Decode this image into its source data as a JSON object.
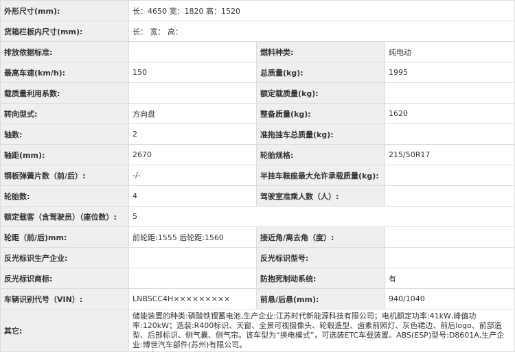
{
  "rows": [
    {
      "l1": "外形尺寸(mm):",
      "v1": "长：4650 宽：1820 高：1520"
    },
    {
      "l1": "货箱栏板内尺寸(mm):",
      "v1": "长： 宽： 高："
    },
    {
      "l1": "排放依据标准:",
      "v1": "",
      "l2": "燃料种类:",
      "v2": "纯电动"
    },
    {
      "l1": "最高车速(km/h):",
      "v1": "150",
      "l2": "总质量(kg):",
      "v2": "1995"
    },
    {
      "l1": "载质量利用系数:",
      "v1": "",
      "l2": "额定载质量(kg):",
      "v2": ""
    },
    {
      "l1": "转向型式:",
      "v1": "方向盘",
      "l2": "整备质量(kg):",
      "v2": "1620"
    },
    {
      "l1": "轴数:",
      "v1": "2",
      "l2": "准拖挂车总质量(kg):",
      "v2": ""
    },
    {
      "l1": "轴距(mm):",
      "v1": "2670",
      "l2": "轮胎规格:",
      "v2": "215/50R17"
    },
    {
      "l1": "钢板弹簧片数（前/后）:",
      "v1": "-/-",
      "l2": "半挂车鞍座最大允许承载质量(kg):",
      "v2": ""
    },
    {
      "l1": "轮胎数:",
      "v1": "4",
      "l2": "驾驶室准乘人数（人）:",
      "v2": ""
    },
    {
      "l1": "额定载客（含驾驶员）（座位数）:",
      "v1": "5"
    },
    {
      "l1": "轮距（前/后)mm:",
      "v1": "前轮距:1555 后轮距:1560",
      "l2": "接近角/离去角（度）:",
      "v2": ""
    },
    {
      "l1": "反光标识生产企业:",
      "v1": "",
      "l2": "反光标识型号:",
      "v2": ""
    },
    {
      "l1": "反光标识商标:",
      "v1": "",
      "l2": "防抱死制动系统:",
      "v2": "有"
    },
    {
      "l1": "车辆识别代号（VIN）:",
      "v1": "LNBSCC4H×××××××××",
      "l2": "前悬/后悬(mm):",
      "v2": "940/1040"
    }
  ],
  "other": {
    "label": "其它:",
    "value": "储能装置的种类:磷酸铁锂蓄电池,生产企业:江苏时代新能源科技有限公司；电机额定功率:41kW,峰值功率:120kW；选装:R400标识、天窗、全景可视摄像头、轮毂造型、卤素前照灯、灰色裙边、前后logo、前部造型、后部标识、侧气囊、侧气帘。该车型为“换电模式”，可选装ETC车载装置。ABS(ESP)型号:D8601A,生产企业:博世汽车部件(苏州)有限公司。"
  }
}
